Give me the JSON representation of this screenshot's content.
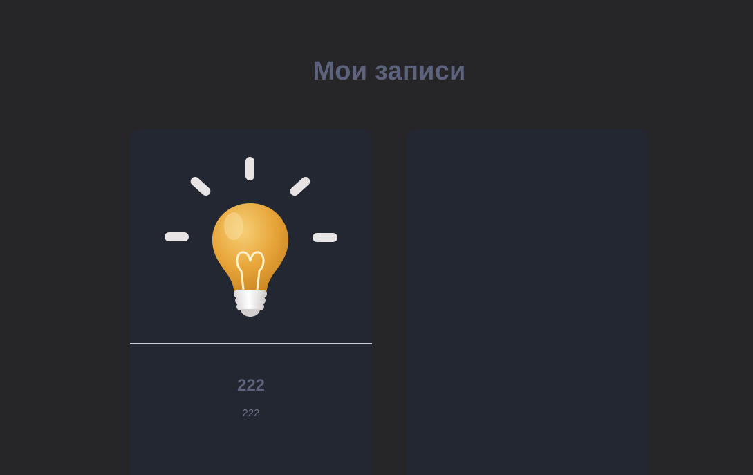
{
  "header": {
    "title": "Мои записи"
  },
  "notes": [
    {
      "title": "222",
      "text": "222",
      "image_icon": "lightbulb-icon"
    }
  ],
  "add_card": {
    "icon": "plus-icon"
  },
  "colors": {
    "background": "#262628",
    "card": "#222731",
    "title_text": "#5d627c",
    "accent_plus": "#0db8ef",
    "bulb": "#e9a93c"
  }
}
